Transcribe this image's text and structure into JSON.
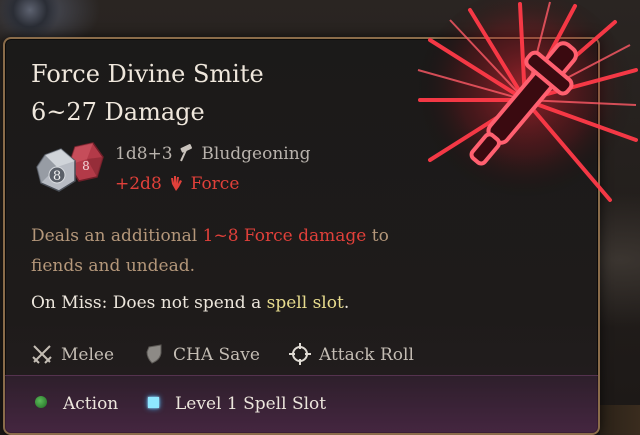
{
  "tooltip": {
    "title": "Force Divine Smite",
    "damage_range": "6~27 Damage",
    "dice": {
      "large_die": "8",
      "small_die": "8"
    },
    "damage_lines": [
      {
        "text": "1d8+3",
        "type": "Bludgeoning",
        "icon": "hammer-icon"
      },
      {
        "text": "+2d8",
        "type": "Force",
        "icon": "force-hand-icon"
      }
    ],
    "description": {
      "pre": "Deals an additional ",
      "highlight": "1~8 Force damage",
      "post": " to fiends and undead."
    },
    "on_miss": {
      "pre": "On Miss: Does not spend a ",
      "highlight": "spell slot",
      "post": "."
    },
    "properties": [
      {
        "label": "Melee",
        "icon": "crossed-swords-icon"
      },
      {
        "label": "CHA Save",
        "icon": "shield-icon"
      },
      {
        "label": "Attack Roll",
        "icon": "crosshair-icon"
      }
    ],
    "cost": [
      {
        "label": "Action",
        "icon": "green-dot-icon"
      },
      {
        "label": "Level 1 Spell Slot",
        "icon": "blue-square-icon"
      }
    ]
  },
  "colors": {
    "title": "#efe7dc",
    "damage_red": "#e0403a",
    "description": "#b4977a",
    "highlight_yellow": "#e8dc8e",
    "border_gold": "#8a6c4a",
    "footer_purple": "#5f2d5a"
  }
}
